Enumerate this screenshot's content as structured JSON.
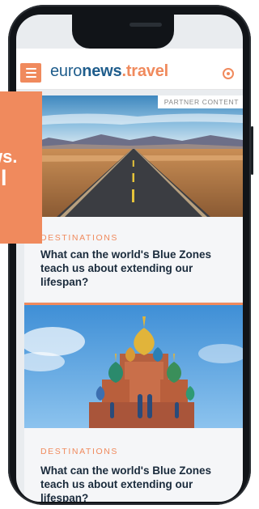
{
  "header": {
    "logo_part1": "euro",
    "logo_part2": "news",
    "logo_part3": ".travel"
  },
  "overlay": {
    "line1": "ws.",
    "line2": "el"
  },
  "articles": [
    {
      "partner_badge": "PARTNER CONTENT",
      "category": "DESTINATIONS",
      "title": "What can the world's Blue Zones teach us about extending our lifespan?",
      "image": "desert-road"
    },
    {
      "category": "DESTINATIONS",
      "title": "What can the world's Blue Zones teach us about extending our lifespan?",
      "image": "onion-dome-cathedral"
    }
  ],
  "icons": {
    "menu": "hamburger-menu-icon",
    "live": "record-circle-icon"
  },
  "colors": {
    "accent": "#f08a5d",
    "brand_blue": "#1f5d8c",
    "title_text": "#1a2b3c"
  }
}
